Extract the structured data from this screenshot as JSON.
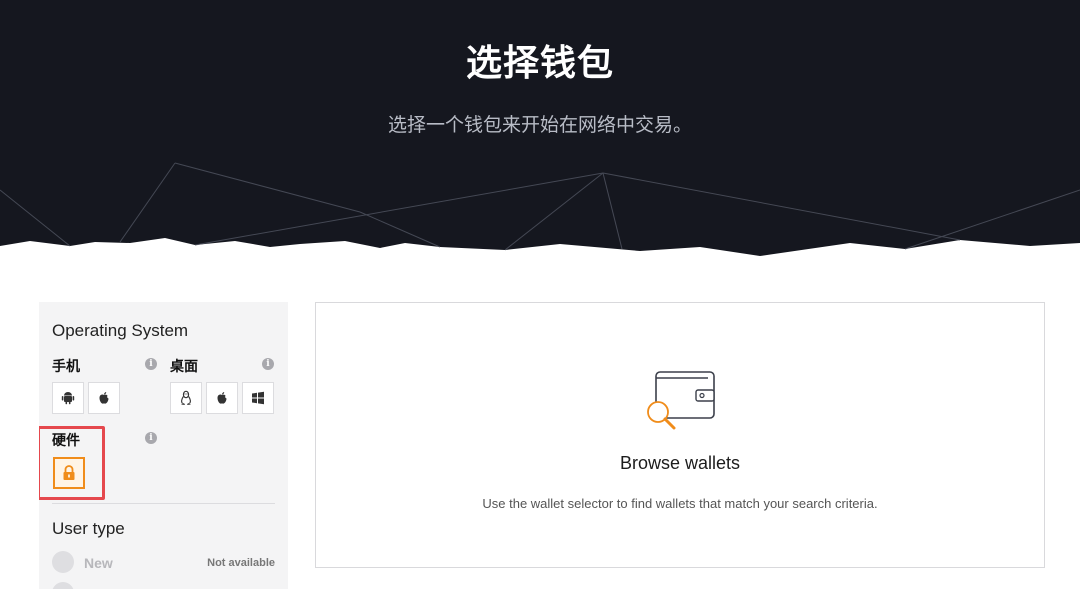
{
  "hero": {
    "title": "选择钱包",
    "subtitle": "选择一个钱包来开始在网络中交易。"
  },
  "filters": {
    "os_title": "Operating System",
    "mobile_label": "手机",
    "desktop_label": "桌面",
    "hardware_label": "硬件",
    "mobile_buttons": [
      "android-icon",
      "apple-icon"
    ],
    "desktop_buttons": [
      "linux-icon",
      "apple-icon",
      "windows-icon"
    ],
    "hardware_buttons": [
      "lock-icon"
    ],
    "user_type_title": "User type",
    "user_types": [
      {
        "label": "New",
        "status": "Not available"
      }
    ]
  },
  "results": {
    "title": "Browse wallets",
    "description": "Use the wallet selector to find wallets that match your search criteria."
  },
  "colors": {
    "hero_bg": "#15171f",
    "accent": "#f08c1a",
    "highlight": "#e5484d"
  }
}
